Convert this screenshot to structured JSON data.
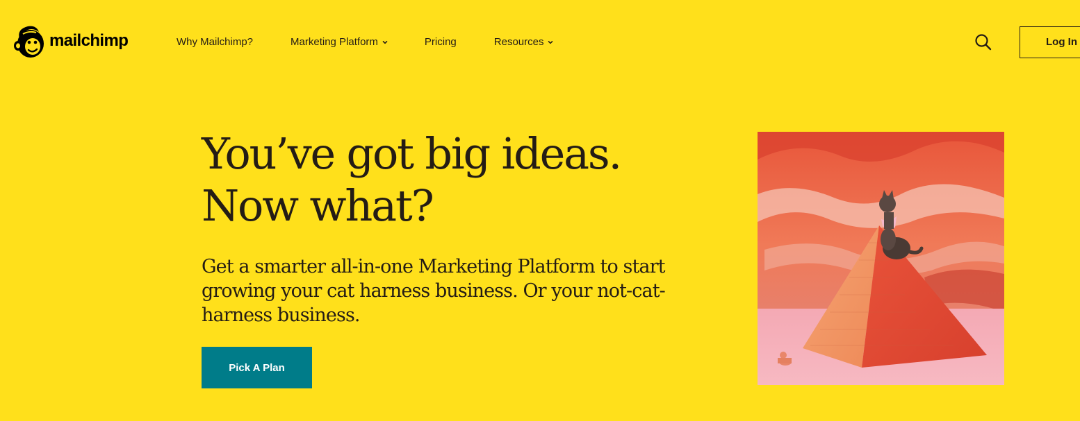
{
  "header": {
    "logo_text": "mailchimp",
    "logo_icon": "freddie-chimp-icon",
    "nav": [
      {
        "label": "Why Mailchimp?",
        "has_dropdown": false
      },
      {
        "label": "Marketing Platform",
        "has_dropdown": true
      },
      {
        "label": "Pricing",
        "has_dropdown": false
      },
      {
        "label": "Resources",
        "has_dropdown": true
      }
    ],
    "search_icon": "search-icon",
    "login_label": "Log In"
  },
  "hero": {
    "title_line1": "You’ve got big ideas.",
    "title_line2": "Now what?",
    "subtitle_line1": "Get a smarter all-in-one Marketing Platform to start",
    "subtitle_line2": "growing your cat harness business. Or your not-cat-",
    "subtitle_line3": "harness business.",
    "cta_label": "Pick A Plan",
    "illustration": "cat-on-pyramid-illustration"
  },
  "colors": {
    "background": "#FFE01B",
    "text": "#241C15",
    "cta": "#007C89",
    "cta_text": "#FFFFFF"
  }
}
